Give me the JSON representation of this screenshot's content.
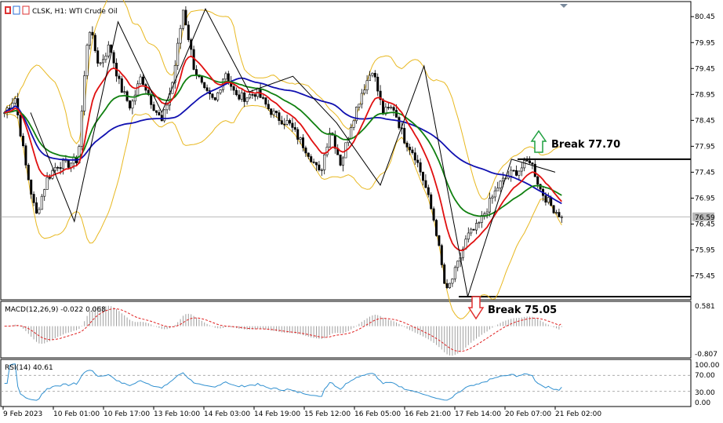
{
  "header": {
    "symbol": "CLSK",
    "timeframe": "H1",
    "instrument": "WTI Crude Oil",
    "title": "CLSK, H1:  WTI Crude Oil"
  },
  "current_price": "76.59",
  "annotations": {
    "break_up": "Break 77.70",
    "break_down": "Break 75.05"
  },
  "colors": {
    "bollinger": "#e8b820",
    "ma_fast": "#e01010",
    "ma_mid": "#108010",
    "ma_slow": "#1010b0",
    "rsi": "#3090d0",
    "macd_signal": "#e02020",
    "macd_hist": "#a0a0a0",
    "arrow_up": "#20a040",
    "arrow_down": "#e03030"
  },
  "chart_data": [
    {
      "type": "candlestick",
      "name": "price",
      "y_ticks": [
        "80.45",
        "79.95",
        "79.45",
        "78.95",
        "78.45",
        "77.95",
        "77.45",
        "76.95",
        "76.45",
        "75.95",
        "75.45"
      ],
      "ylim": [
        75.05,
        80.65
      ],
      "x_ticks": [
        "9 Feb 2023",
        "10 Feb 01:00",
        "10 Feb 17:00",
        "13 Feb 10:00",
        "14 Feb 03:00",
        "14 Feb 19:00",
        "15 Feb 12:00",
        "16 Feb 05:00",
        "16 Feb 21:00",
        "17 Feb 14:00",
        "20 Feb 07:00",
        "21 Feb 02:00"
      ],
      "close_path": [
        78.6,
        78.9,
        77.6,
        76.6,
        77.3,
        77.6,
        77.6,
        77.7,
        80.3,
        79.5,
        79.9,
        79.1,
        78.7,
        79.3,
        78.8,
        78.4,
        79.2,
        80.6,
        79.5,
        79.0,
        78.8,
        79.4,
        78.9,
        78.9,
        79.0,
        78.7,
        78.5,
        78.4,
        78.1,
        77.8,
        77.4,
        78.3,
        77.6,
        78.4,
        79.0,
        79.45,
        78.6,
        78.7,
        78.1,
        77.8,
        77.2,
        76.4,
        75.1,
        75.6,
        76.2,
        76.4,
        76.8,
        77.2,
        77.4,
        77.5,
        77.7,
        77.1,
        76.8,
        76.59
      ],
      "zigzag": [
        78.6,
        76.5,
        80.35,
        78.6,
        80.6,
        79.0,
        79.3,
        78.4,
        77.2,
        79.5,
        75.05,
        77.7,
        77.45
      ],
      "overlays": [
        "Bollinger Bands",
        "MA fast",
        "MA mid",
        "MA slow"
      ],
      "levels": [
        {
          "label": "Break 77.70",
          "value": 77.7,
          "direction": "up"
        },
        {
          "label": "Break 75.05",
          "value": 75.05,
          "direction": "down"
        }
      ],
      "last": 76.59
    },
    {
      "type": "bar",
      "name": "MACD",
      "label": "MACD(12,26,9) -0.022 0.068",
      "params": [
        12,
        26,
        9
      ],
      "main": -0.022,
      "signal": 0.068,
      "y_ticks": [
        "0.581",
        "-0.807"
      ],
      "ylim": [
        -0.807,
        0.581
      ]
    },
    {
      "type": "line",
      "name": "RSI",
      "label": "RSI(14) 40.61",
      "period": 14,
      "value": 40.61,
      "y_ticks": [
        "100.00",
        "70.00",
        "30.00",
        "0.00"
      ],
      "ylim": [
        0,
        100
      ]
    }
  ]
}
